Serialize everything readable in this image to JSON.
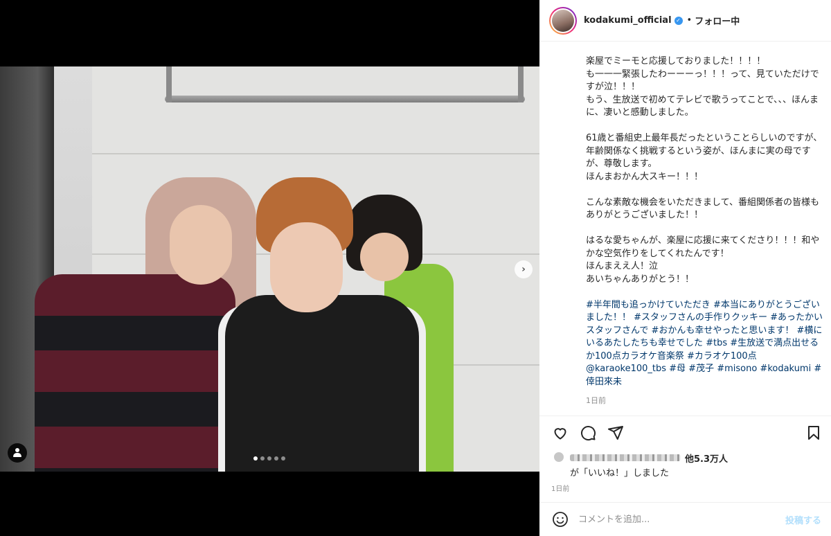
{
  "post": {
    "username": "kodakumi_official",
    "separator": "•",
    "follow_status": "フォロー中",
    "caption": "楽屋でミーモと応援しておりました！！！！\nも一一一緊張したわーーーっ！！！って、見ていただけですが泣！！！\nもう、生放送で初めてテレビで歌うってことで、、、ほんまに、凄いと感動しました。\n\n61歳と番組史上最年長だったということらしいのですが、年齢関係なく挑戦するという姿が、ほんまに実の母ですが、尊敬します。\nほんまおかん大スキー！！！\n\nこんな素敵な機会をいただきまして、番組関係者の皆様もありがとうございました！！\n\nはるな愛ちゃんが、楽屋に応援に来てくださり！！！和やかな空気作りをしてくれたんです！\nほんまええ人！泣\nあいちゃんありがとう！！\n\n",
    "hashtags": "#半年間も追っかけていただき #本当にありがとうございました！！ #スタッフさんの手作りクッキー #あったかいスタッフさんで #おかんも幸せやったと思います！ #横にいるあたしたちも幸せでした #tbs #生放送で満点出せるか100点カラオケ音楽祭 #カラオケ100点 @karaoke100_tbs #母 #茂子 #misono #kodakumi #倖田來未",
    "caption_time": "1日前",
    "likes_count": "他5.3万人",
    "likes_text": "が「いいね！」しました",
    "post_time": "1日前",
    "comment_placeholder": "コメントを追加...",
    "post_button": "投稿する"
  },
  "carousel": {
    "total": 5,
    "active": 0
  },
  "colors": {
    "link": "#00376b",
    "verified": "#3897f0",
    "post_disabled": "#b2dffc"
  }
}
